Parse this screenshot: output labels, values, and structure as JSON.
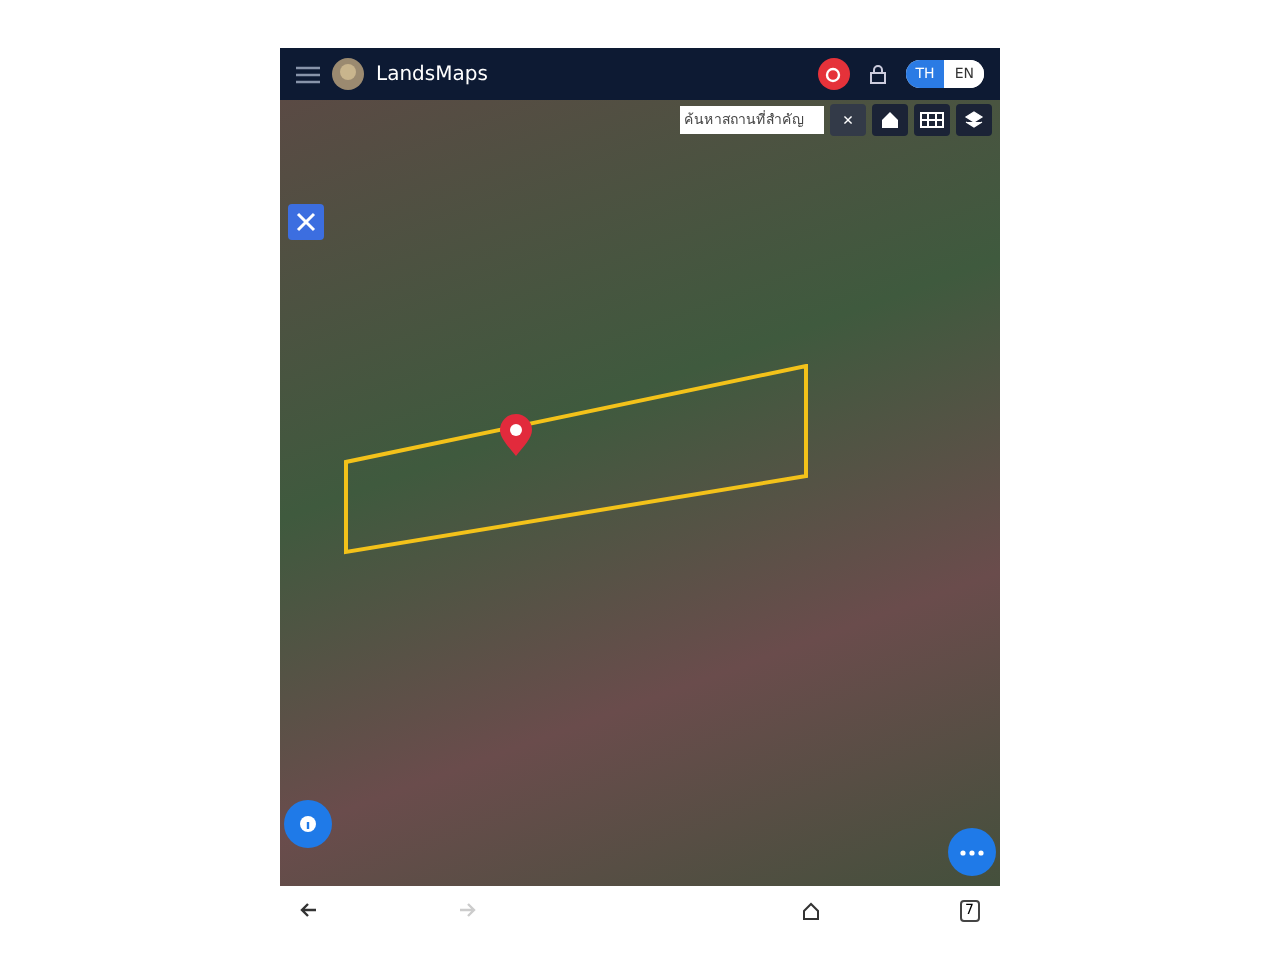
{
  "header": {
    "app_name": "LandsMaps",
    "languages": [
      {
        "label": "TH",
        "selected": true
      },
      {
        "label": "EN",
        "selected": false
      }
    ]
  },
  "map": {
    "search": {
      "placeholder": "ค้นหาสถานที่สำคัญ",
      "clear_label": "×"
    }
  },
  "browser_nav": {
    "back": {
      "disabled": false
    },
    "forward": {
      "disabled": true
    },
    "tab_count": "7"
  }
}
